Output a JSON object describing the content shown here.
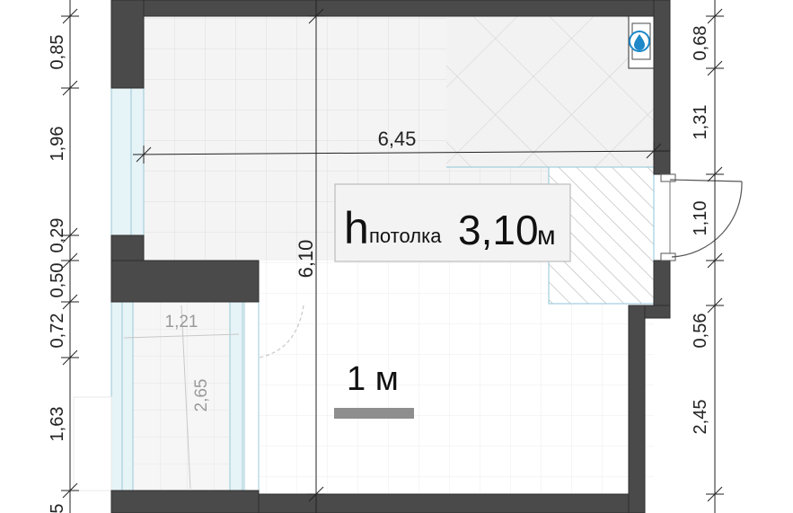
{
  "colors": {
    "wall": "#4a4a4a",
    "floor": "#f3f3f3",
    "glass": "#dceef3",
    "accent_water": "#1e88c8",
    "dim_line": "#222222",
    "scale_bar": "#8e8e8e"
  },
  "icons": [
    "water-drop-icon"
  ],
  "left_dims": [
    "0,85",
    "1,96",
    "0,29",
    "0,50",
    "0,72",
    "1,63",
    "5"
  ],
  "right_dims": [
    "0,68",
    "1,31",
    "1,10",
    "0,56",
    "2,45"
  ],
  "room": {
    "width": "6,45",
    "length": "6,10"
  },
  "balcony": {
    "width": "1,21",
    "length": "2,65"
  },
  "ceiling": {
    "h": "h",
    "label": "потолка",
    "value": "3,10",
    "unit": "м"
  },
  "scale": {
    "label": "1 м"
  }
}
